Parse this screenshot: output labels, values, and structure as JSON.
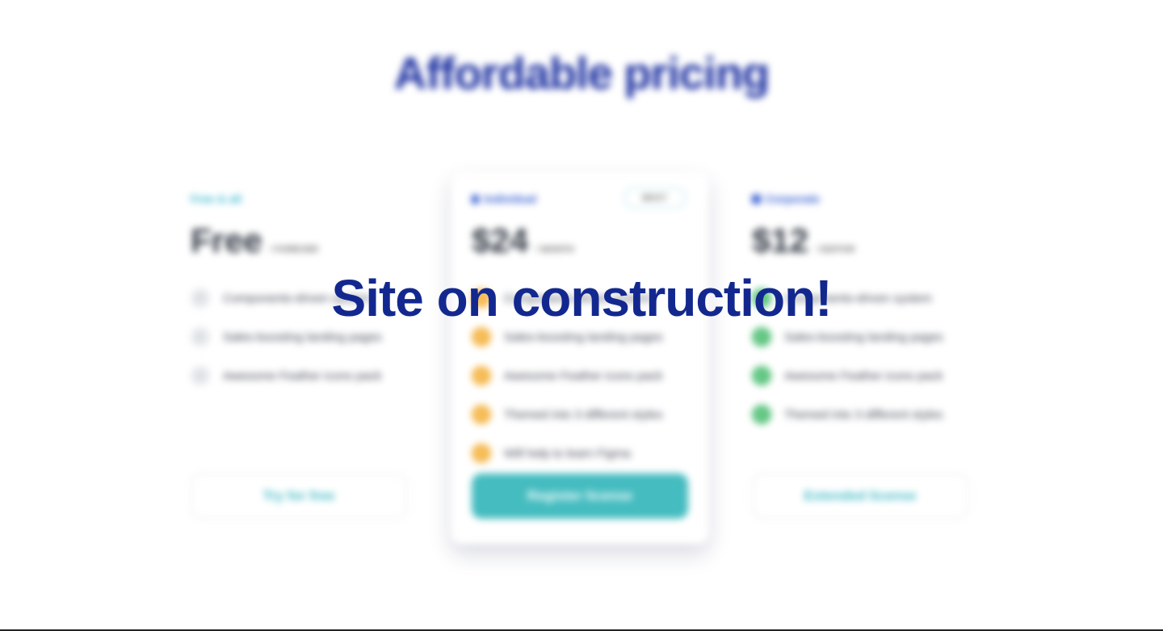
{
  "heading": "Affordable pricing",
  "message": "Site on construction!",
  "plans": [
    {
      "name": "Free & all",
      "price": "Free",
      "period": "/ FOREVER",
      "features": [
        "Components-driven system",
        "Sales-boosting landing pages",
        "Awesome Feather icons pack"
      ],
      "cta": "Try for free"
    },
    {
      "name": "Individual",
      "badge": "BEST",
      "price": "$24",
      "period": "/ MONTH",
      "features": [
        "Components-driven system",
        "Sales-boosting landing pages",
        "Awesome Feather icons pack",
        "Themed into 3 different styles",
        "Will help to learn Figma"
      ],
      "cta": "Register license"
    },
    {
      "name": "Corporate",
      "price": "$12",
      "period": "/ EDITOR",
      "features": [
        "Components-driven system",
        "Sales-boosting landing pages",
        "Awesome Feather icons pack",
        "Themed into 3 different styles"
      ],
      "cta": "Extended license"
    }
  ],
  "colors": {
    "heading": "#1a2ea0",
    "message": "#13288f",
    "accent": "#45bcc0",
    "check_free": "#e6e8ec",
    "check_individual": "#f5b648",
    "check_corporate": "#57c27a"
  },
  "icons": {
    "check": "check-icon",
    "individual": "user-icon",
    "corporate": "building-icon"
  }
}
